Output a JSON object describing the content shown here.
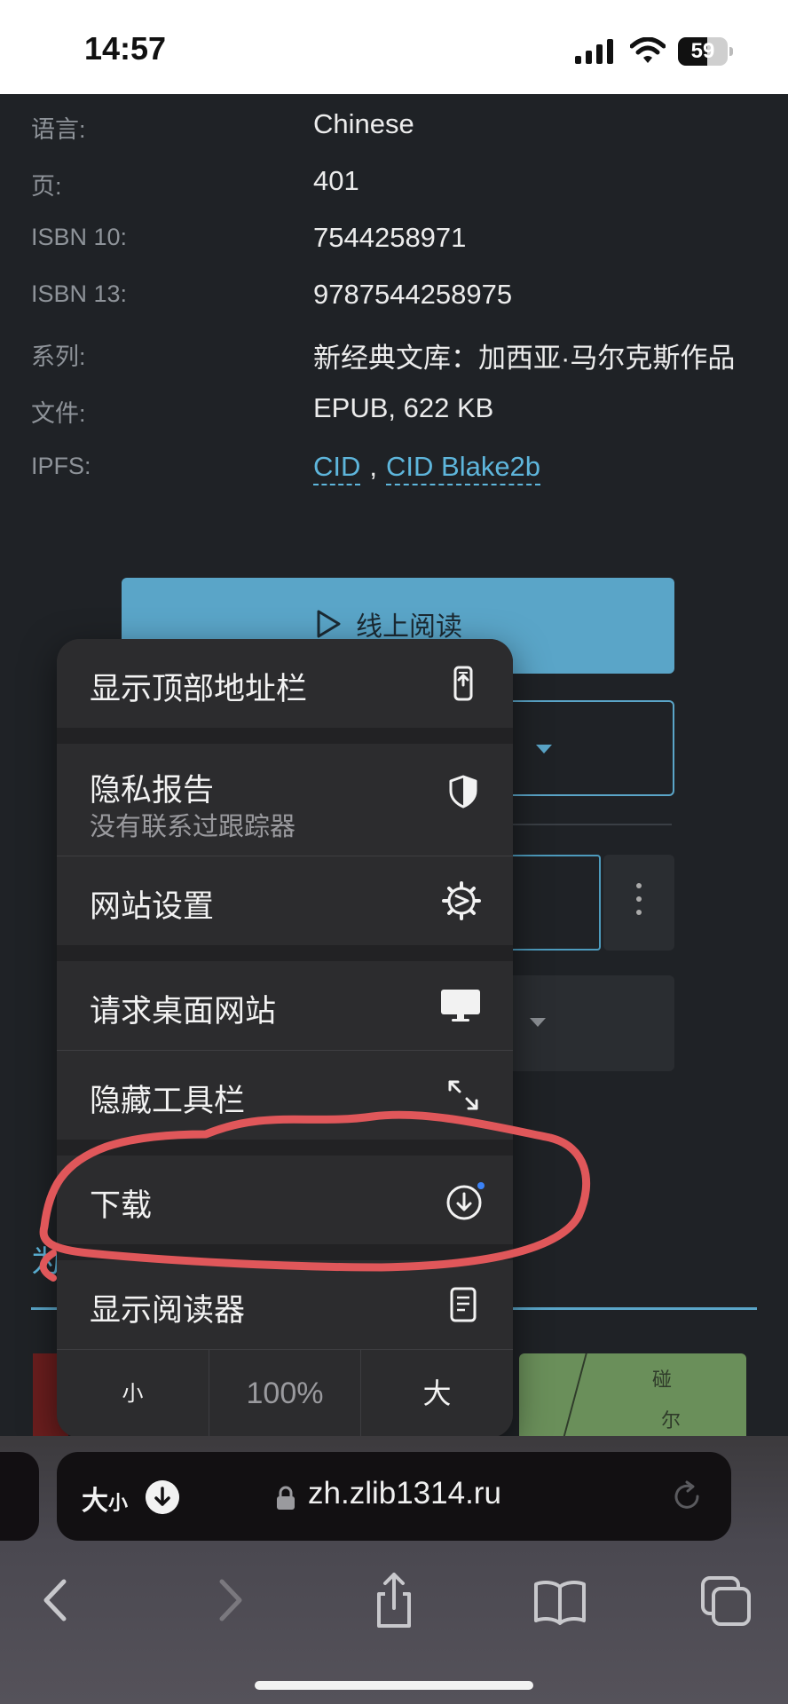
{
  "status_bar": {
    "time": "14:57",
    "battery_level": "59",
    "battery_fraction": 0.59
  },
  "book_meta": [
    {
      "label": "语言:",
      "value": "Chinese"
    },
    {
      "label": "页:",
      "value": "401"
    },
    {
      "label": "ISBN 10:",
      "value": "7544258971"
    },
    {
      "label": "ISBN 13:",
      "value": "9787544258975"
    },
    {
      "label": "系列:",
      "value": "新经典文库：加西亚·马尔克斯作品"
    },
    {
      "label": "文件:",
      "value": "EPUB, 622 KB"
    }
  ],
  "ipfs": {
    "label": "IPFS:",
    "link1": "CID",
    "separator": ",",
    "link2": "CID Blake2b"
  },
  "read_online_button": "线上阅读",
  "section_partial_char": "为",
  "cover_chars": [
    "碰",
    "尔"
  ],
  "context_menu": {
    "show_top_address_bar": "显示顶部地址栏",
    "privacy_report": "隐私报告",
    "privacy_report_sub": "没有联系过跟踪器",
    "website_settings": "网站设置",
    "request_desktop_site": "请求桌面网站",
    "hide_toolbar": "隐藏工具栏",
    "downloads": "下载",
    "show_reader": "显示阅读器",
    "zoom_small": "小",
    "zoom_level": "100%",
    "zoom_large": "大"
  },
  "address_bar": {
    "aa_label": "大",
    "aa_small": "小",
    "url": "zh.zlib1314.ru"
  },
  "colors": {
    "accent": "#5aa5c8",
    "link": "#5eb6dc",
    "scribble": "#e0575a",
    "download_dot": "#3b82f6"
  },
  "icons": [
    "signal-icon",
    "wifi-icon",
    "battery-icon",
    "play-icon",
    "phone-arrow-up-icon",
    "shield-icon",
    "gear-icon",
    "desktop-icon",
    "expand-arrows-icon",
    "download-icon",
    "reader-icon",
    "lock-icon",
    "reload-icon",
    "back-icon",
    "forward-icon",
    "share-icon",
    "bookmarks-icon",
    "tabs-icon"
  ]
}
